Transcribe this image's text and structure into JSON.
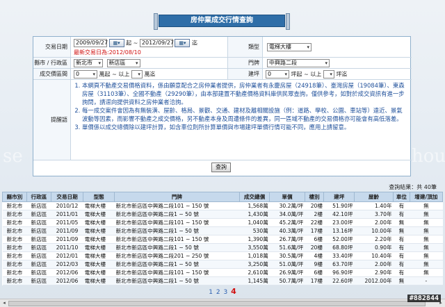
{
  "title": "房仲業成交行情查詢",
  "form": {
    "date_label": "交易日期",
    "date_start": "2009/09/27",
    "date_sep": "起 ~",
    "date_end": "2012/09/27",
    "date_to": "迄",
    "latest_note": "最新交易日為:2012/08/10",
    "type_label": "類型",
    "type_value": "電梯大樓",
    "district_label": "縣市 / 行政區",
    "city_value": "新北市",
    "town_value": "新店區",
    "street_label": "門牌",
    "street_value": "中興路二段",
    "price_label": "成交價區間",
    "price_min": "0",
    "price_mid": "萬起 ~ 以上",
    "price_to": "萬迄",
    "area_label": "建坪",
    "area_min": "0",
    "area_mid": "坪起 ~ 以上",
    "area_to": "坪迄",
    "hint_label": "提醒語",
    "hints": [
      "本網頁不動產交易價格資料，係由願意配合之房仲業者提供，房仲業者有永慶房屋（24918筆）、臺灣房屋（19084筆）、東森房屋（31103筆）、全國不動產（29290筆），由本部建置不動產價格資料庫供民眾查詢，僅供參考，如對於成交資訊有進一步詢問，請逕向提供資料之房仲業者洽詢。",
      "每一成交案件會因為有無裝潢、屋齡、格局、景觀、交通、建材及離相關設施（例：道路、學校、公園、車站等）遠近、景氣波動等因素，而影響不動產之成交價格，另不動產本身及周遭條件的差異，同一區域不動產的交易價格亦可能會有高低落差。",
      "單價係以成交總價除以建坪計算，如含車位則所計算單價與市場建坪單價行情可能不同，應用上請留意。"
    ],
    "query_label": "查詢"
  },
  "results": {
    "count_text": "查詢結果：共 40筆",
    "columns": [
      "縣市別",
      "行政區",
      "交易日期",
      "型態",
      "門牌",
      "成交總價",
      "單價",
      "樓別",
      "建坪",
      "屋齡",
      "車位",
      "增建/頂加"
    ],
    "rows": [
      [
        "新北市",
        "新店區",
        "2010/12",
        "電梯大樓",
        "新北市新店區中興路二段101 ~ 150 號",
        "1,568萬",
        "30.2萬/坪",
        "20樓",
        "51.90坪",
        "1.40年",
        "有",
        "無"
      ],
      [
        "新北市",
        "新店區",
        "2011/01",
        "電梯大樓",
        "新北市新店區中興路二段1 ~ 50 號",
        "1,430萬",
        "34.0萬/坪",
        "2樓",
        "42.10坪",
        "3.70年",
        "有",
        "無"
      ],
      [
        "新北市",
        "新店區",
        "2011/05",
        "電梯大樓",
        "新北市新店區中興路二段101 ~ 150 號",
        "1,040萬",
        "45.2萬/坪",
        "22樓",
        "23.00坪",
        "2.00年",
        "無",
        "無"
      ],
      [
        "新北市",
        "新店區",
        "2011/09",
        "電梯大樓",
        "新北市新店區中興路二段1 ~ 50 號",
        "530萬",
        "40.3萬/坪",
        "17樓",
        "13.16坪",
        "10.00年",
        "無",
        "無"
      ],
      [
        "新北市",
        "新店區",
        "2011/09",
        "電梯大樓",
        "新北市新店區中興路二段101 ~ 150 號",
        "1,390萬",
        "26.7萬/坪",
        "6樓",
        "52.00坪",
        "2.20年",
        "有",
        "無"
      ],
      [
        "新北市",
        "新店區",
        "2011/10",
        "電梯大樓",
        "新北市新店區中興路二段1 ~ 50 號",
        "3,550萬",
        "51.6萬/坪",
        "20樓",
        "68.80坪",
        "0.90年",
        "有",
        "無"
      ],
      [
        "新北市",
        "新店區",
        "2012/01",
        "電梯大樓",
        "新北市新店區中興路二段201 ~ 250 號",
        "1,018萬",
        "30.5萬/坪",
        "4樓",
        "33.40坪",
        "10.40年",
        "有",
        "無"
      ],
      [
        "新北市",
        "新店區",
        "2012/03",
        "電梯大樓",
        "新北市新店區中興路二段1 ~ 50 號",
        "3,250萬",
        "51.0萬/坪",
        "9樓",
        "63.70坪",
        "2.00年",
        "有",
        "無"
      ],
      [
        "新北市",
        "新店區",
        "2012/06",
        "電梯大樓",
        "新北市新店區中興路二段101 ~ 150 號",
        "2,610萬",
        "26.9萬/坪",
        "6樓",
        "96.90坪",
        "2.90年",
        "有",
        "無"
      ],
      [
        "新北市",
        "新店區",
        "2012/06",
        "電梯大樓",
        "新北市新店區中興路二段1 ~ 50 號",
        "1,145萬",
        "50.7萬/坪",
        "17樓",
        "22.60坪",
        "2012.00年",
        "無",
        "-"
      ]
    ],
    "pages": [
      "1",
      "2",
      "3"
    ],
    "current_page": "4"
  },
  "watermark": "#882844",
  "colors": {
    "title_bar": "#2f6ea8",
    "header_bg": "#c6d9ec",
    "info_text": "#1e4f9a",
    "alert": "#d01010"
  }
}
